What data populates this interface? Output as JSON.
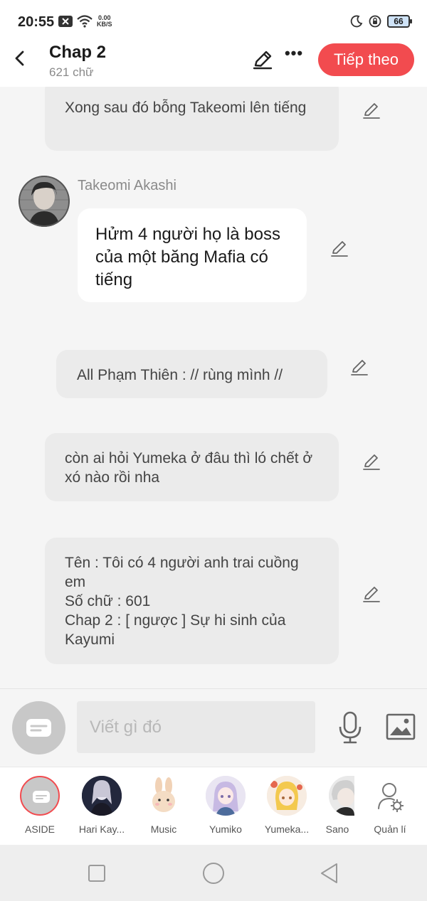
{
  "status_bar": {
    "time": "20:55",
    "net_speed_value": "0.00",
    "net_speed_unit": "KB/S",
    "battery": "66"
  },
  "header": {
    "title": "Chap 2",
    "subtitle": "621 chữ",
    "next_label": "Tiếp theo"
  },
  "chat": {
    "messages": [
      {
        "type": "narration",
        "text": "Xong sau đó bỗng Takeomi lên tiếng"
      },
      {
        "type": "character",
        "speaker": "Takeomi Akashi",
        "text": "Hửm 4 người họ là boss của một băng Mafia có tiếng"
      },
      {
        "type": "narration",
        "text": "All Phạm Thiên : // rùng mình //"
      },
      {
        "type": "narration",
        "text": "còn ai hỏi Yumeka ở đâu thì ló chết ở xó nào rồi nha"
      },
      {
        "type": "narration",
        "lines": [
          "Tên : Tôi có 4 người anh trai cuồng em",
          "Số chữ : 601",
          "Chap 2 : [ ngược ] Sự hi sinh của Kayumi"
        ]
      }
    ]
  },
  "composer": {
    "placeholder": "Viết gì đó"
  },
  "tray": {
    "items": [
      {
        "label": "ASIDE"
      },
      {
        "label": "Hari Kay..."
      },
      {
        "label": "Music"
      },
      {
        "label": "Yumiko"
      },
      {
        "label": "Yumeka..."
      },
      {
        "label": "Sano"
      },
      {
        "label": "Quản lí"
      }
    ]
  },
  "colors": {
    "accent": "#f24b4f",
    "narration_bubble": "#ebebeb",
    "background": "#f5f5f5"
  },
  "icons": [
    "chevron-left-icon",
    "pencil-icon",
    "more-icon",
    "microphone-icon",
    "image-icon",
    "person-gear-icon",
    "square-icon",
    "circle-icon",
    "triangle-back-icon"
  ]
}
